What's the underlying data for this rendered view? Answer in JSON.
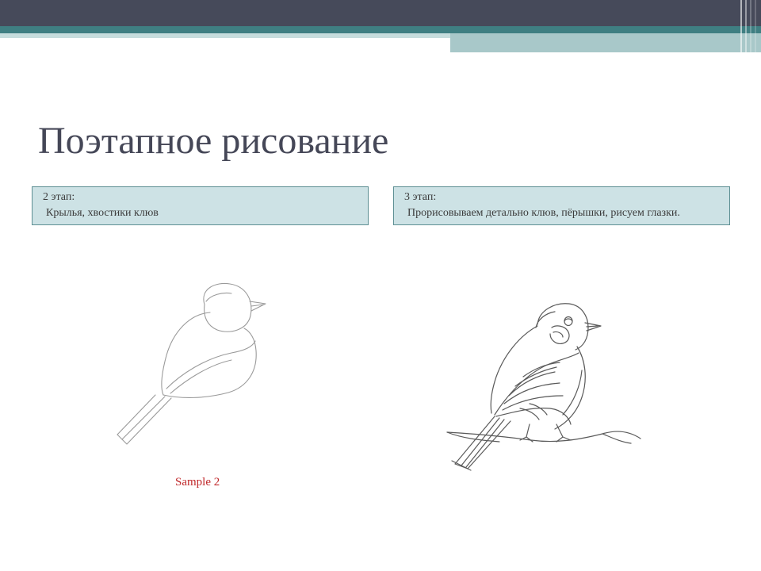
{
  "slide": {
    "title": "Поэтапное рисование",
    "colors": {
      "topbar": "#464a5a",
      "teal_stripe": "#3f7f82",
      "light_stripe": "#c6dddd",
      "stripe_block": "#a8c8c9",
      "caption_bg": "#cde2e5",
      "caption_border": "#5d8f93",
      "title_text": "#454757",
      "sample_text": "#c0282a"
    }
  },
  "left_panel": {
    "caption_line1": "2 этап:",
    "caption_line2": "Крылья, хвостики клюв",
    "sample_label": "Sample 2"
  },
  "right_panel": {
    "caption_line1": "3 этап:",
    "caption_line2": "Прорисовываем детально клюв, пёрышки, рисуем глазки."
  }
}
